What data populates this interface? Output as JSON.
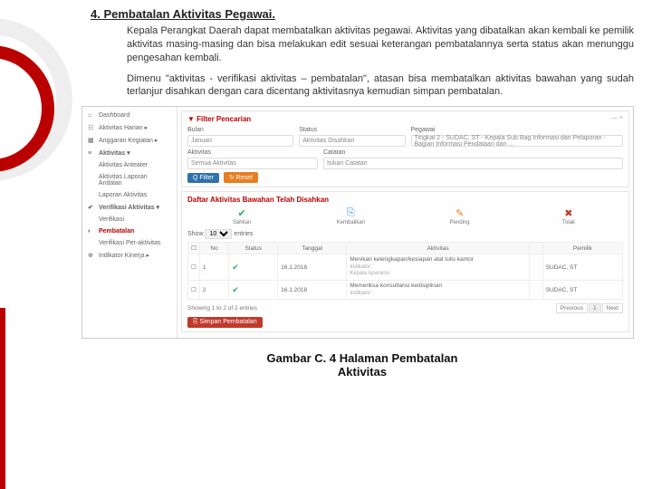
{
  "heading_num": "4. ",
  "heading_title": "Pembatalan Aktivitas Pegawai.",
  "para1": "Kepala Perangkat Daerah dapat membatalkan aktivitas pegawai. Aktivitas yang dibatalkan akan kembali ke pemilik aktivitas masing-masing dan bisa melakukan edit sesuai keterangan pembatalannya serta status akan menunggu pengesahan kembali.",
  "para2": "Dimenu \"aktivitas - verifikasi aktivitas – pembatalan\",  atasan bisa membatalkan aktivitas bawahan yang sudah terlanjur disahkan dengan cara dicentang aktivitasnya kemudian simpan pembatalan.",
  "sidebar": [
    {
      "icon": "⌂",
      "label": "Dashboard"
    },
    {
      "icon": "☷",
      "label": "Aktivitas Harian ▸"
    },
    {
      "icon": "▦",
      "label": "Anggaran Kegiatan ▸"
    },
    {
      "icon": "≡",
      "label": "Aktivitas ▾",
      "bold": true
    },
    {
      "icon": "",
      "label": "Aktivitas Anteater"
    },
    {
      "icon": "",
      "label": "Aktivitas Laporan Andalan"
    },
    {
      "icon": "",
      "label": "Laporan Aktivitas"
    },
    {
      "icon": "✔",
      "label": "Verifikasi Aktivitas ▾",
      "bold": true
    },
    {
      "icon": "",
      "label": "Verifikasi"
    },
    {
      "icon": "›",
      "label": "Pembatalan",
      "active": true
    },
    {
      "icon": "",
      "label": "Verifikasi Per-aktivitas"
    },
    {
      "icon": "⊕",
      "label": "Indikator Kinerja ▸"
    }
  ],
  "filter": {
    "title": "▼ Filter Pencarian",
    "lbl_bulan": "Bulan",
    "val_bulan": "Januari",
    "lbl_status": "Status",
    "val_status": "Aktivitas Disahkan",
    "lbl_pegawai": "Pegawai",
    "val_pegawai": "Tingkat 2 - SUDAC, ST - Kepala Sub Bag Informasi dan Pelaporan - Bagian Informasi Pendataan dan ...",
    "lbl_aktivitas": "Aktivitas",
    "val_aktivitas": "Semua Aktivitas",
    "lbl_catatan": "Catatan",
    "val_catatan": "Isikan Catatan",
    "btn_filter": "Q Filter",
    "btn_reset": "↻ Reset"
  },
  "daftar": {
    "title": "Daftar Aktivitas Bawahan Telah Disahkan",
    "icons": [
      {
        "ic": "✔",
        "cls": "green",
        "lbl": "Sahkan"
      },
      {
        "ic": "⎘",
        "cls": "blue",
        "lbl": "Kembalikan"
      },
      {
        "ic": "✎",
        "cls": "orange",
        "lbl": "Pending"
      },
      {
        "ic": "✖",
        "cls": "redc",
        "lbl": "Tolak"
      }
    ],
    "show_a": "Show",
    "show_b": "entries",
    "show_opt": "10",
    "cols": [
      "",
      "No",
      "Status",
      "Tanggal",
      "Aktivitas",
      "",
      "Pemilik"
    ],
    "rows": [
      {
        "no": "1",
        "tgl": "16.1.2018",
        "a": "Menikari kelengkapan/kesiapan alat tulis kantor",
        "b": "Indikator :",
        "c": "Kepala Aparansi",
        "p1": "SUDAC, ST",
        "p2": ""
      },
      {
        "no": "2",
        "tgl": "16.1.2018",
        "a": "Memeriksa konsultansi kedisiplinan",
        "b": "Indikator :",
        "c": "",
        "p1": "SUDAC, ST",
        "p2": ""
      }
    ],
    "showing": "Showing 1 to 2 of 2 entries",
    "simpan": "⎘ Simpan Pembatalan",
    "prev": "Previous",
    "page": "1",
    "next": "Next"
  },
  "caption1": "Gambar C. 4 Halaman Pembatalan",
  "caption2": "Aktivitas"
}
